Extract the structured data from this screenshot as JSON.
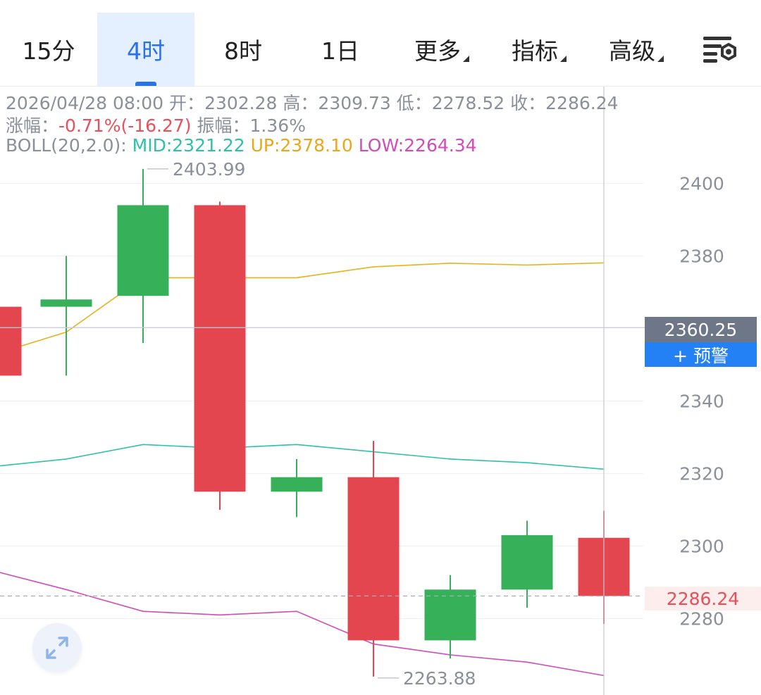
{
  "tabs": [
    {
      "label": "15分",
      "active": false,
      "dropdown": false
    },
    {
      "label": "4时",
      "active": true,
      "dropdown": false
    },
    {
      "label": "8时",
      "active": false,
      "dropdown": false
    },
    {
      "label": "1日",
      "active": false,
      "dropdown": false
    },
    {
      "label": "更多",
      "active": false,
      "dropdown": true
    },
    {
      "label": "指标",
      "active": false,
      "dropdown": true
    },
    {
      "label": "高级",
      "active": false,
      "dropdown": true
    }
  ],
  "info": {
    "datetime": "2026/04/28 08:00",
    "open_label": "开：",
    "open": "2302.28",
    "high_label": "高：",
    "high": "2309.73",
    "low_label": "低：",
    "low": "2278.52",
    "close_label": "收：",
    "close": "2286.24",
    "change_label": "涨幅：",
    "change": "-0.71%(-16.27)",
    "amplitude_label": "振幅：",
    "amplitude": "1.36%",
    "boll_label": "BOLL(20,2.0):",
    "boll_mid": "MID:2321.22",
    "boll_up": "UP:2378.10",
    "boll_low": "LOW:2264.34"
  },
  "crosshair_price": "2360.25",
  "alert_button": "+ 预警",
  "last_price": "2286.24",
  "colors": {
    "up": "#36b15a",
    "down": "#e4464f",
    "mid": "#2fc1a8",
    "upper": "#e8b21a",
    "lower": "#d24cb8",
    "accent": "#2a72e6"
  },
  "icons": {
    "settings": "settings-gear-icon",
    "expand": "expand-icon"
  },
  "chart_data": {
    "type": "candlestick",
    "ylim": [
      2260,
      2410
    ],
    "yticks": [
      2400,
      2380,
      2340,
      2320,
      2300,
      2280
    ],
    "candles": [
      {
        "open": 2366,
        "close": 2347,
        "high": 2366,
        "low": 2347,
        "partial": true
      },
      {
        "open": 2366,
        "close": 2368,
        "high": 2380,
        "low": 2347
      },
      {
        "open": 2369,
        "close": 2394,
        "high": 2404,
        "low": 2356
      },
      {
        "open": 2394,
        "close": 2315,
        "high": 2395,
        "low": 2310
      },
      {
        "open": 2315,
        "close": 2319,
        "high": 2324,
        "low": 2308
      },
      {
        "open": 2319,
        "close": 2274,
        "high": 2329,
        "low": 2264
      },
      {
        "open": 2274,
        "close": 2288,
        "high": 2292,
        "low": 2269
      },
      {
        "open": 2288,
        "close": 2303,
        "high": 2307,
        "low": 2283
      },
      {
        "open": 2302.28,
        "close": 2286.24,
        "high": 2309.73,
        "low": 2278.52
      }
    ],
    "boll": {
      "upper": [
        2353,
        2359,
        2374,
        2374,
        2374,
        2377,
        2378,
        2377.5,
        2378.1
      ],
      "mid": [
        2322,
        2324,
        2328,
        2327,
        2328,
        2326,
        2324,
        2323,
        2321.2
      ],
      "lower": [
        2293,
        2288,
        2282,
        2281,
        2282,
        2273,
        2270,
        2268,
        2264.3
      ]
    },
    "high_label": "2403.99",
    "low_label": "2263.88",
    "crosshair_value": 2360.25,
    "last_value": 2286.24
  }
}
